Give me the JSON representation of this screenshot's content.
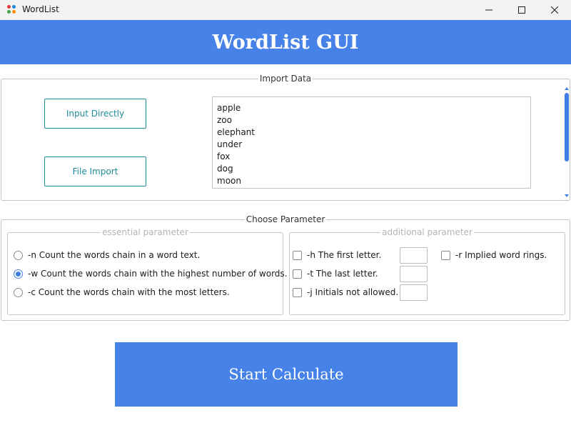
{
  "window": {
    "title": "WordList",
    "app_icon": "app-dots-icon"
  },
  "header": {
    "title": "WordList GUI",
    "color": "#4682e8"
  },
  "import": {
    "legend": "Import Data",
    "input_directly_label": "Input Directly",
    "file_import_label": "File Import",
    "words": [
      "apple",
      "zoo",
      "elephant",
      "under",
      "fox",
      "dog",
      "moon"
    ]
  },
  "params": {
    "legend": "Choose Parameter",
    "essential": {
      "legend": "essential parameter",
      "options": [
        {
          "label": "-n Count the words chain in a word text.",
          "selected": false
        },
        {
          "label": "-w Count the words chain with the highest number of words.",
          "selected": true
        },
        {
          "label": "-c Count the words chain with the most letters.",
          "selected": false
        }
      ]
    },
    "additional": {
      "legend": "additional parameter",
      "h_label": "-h The first letter.",
      "t_label": "-t The last letter.",
      "j_label": "-j Initials not allowed.",
      "r_label": "-r Implied word rings."
    }
  },
  "action": {
    "start_label": "Start Calculate"
  },
  "colors": {
    "accent": "#4682e8",
    "teal": "#1f8c98"
  }
}
